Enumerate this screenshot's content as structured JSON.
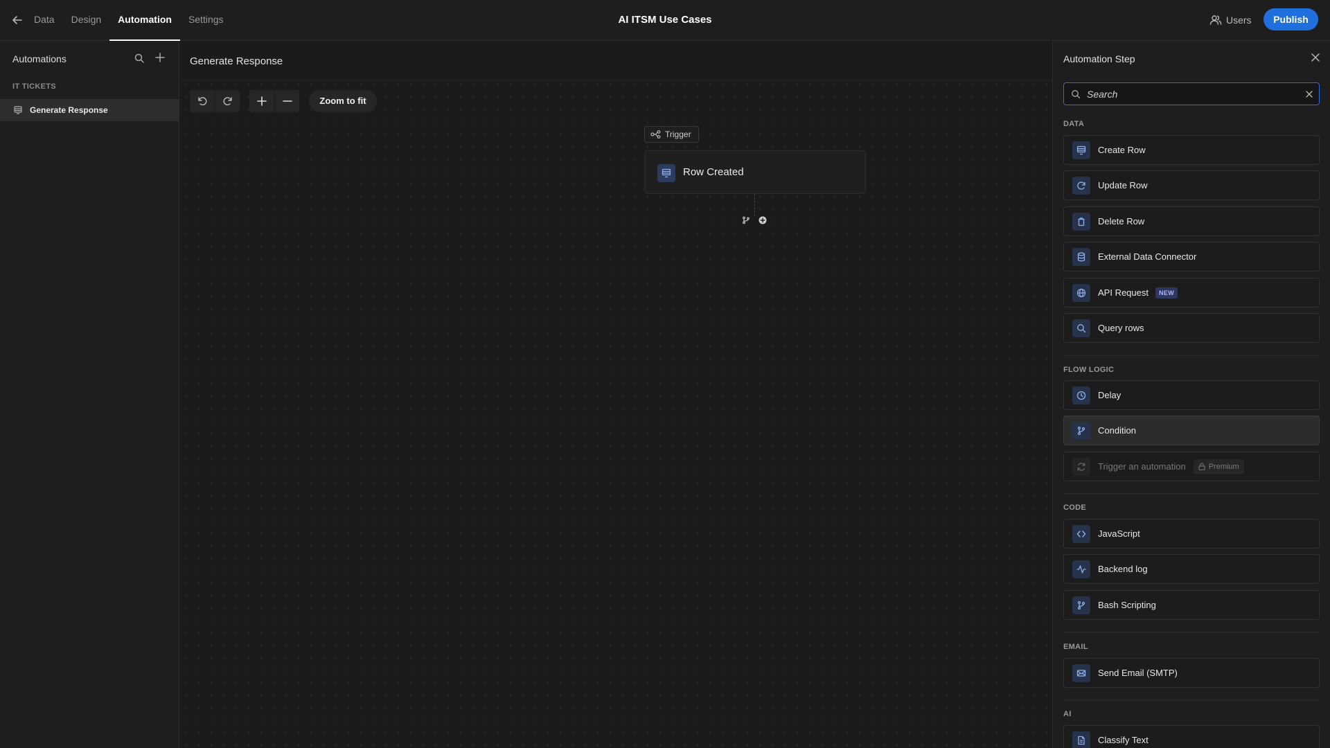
{
  "nav": {
    "back_icon": "arrow-left-icon",
    "tabs": [
      {
        "label": "Data",
        "active": false
      },
      {
        "label": "Design",
        "active": false
      },
      {
        "label": "Automation",
        "active": true
      },
      {
        "label": "Settings",
        "active": false
      }
    ],
    "app_title": "AI ITSM Use Cases",
    "users_label": "Users",
    "publish_label": "Publish"
  },
  "sidebar": {
    "title": "Automations",
    "section": "IT TICKETS",
    "items": [
      {
        "label": "Generate Response",
        "icon": "table-rows-icon",
        "selected": true
      }
    ]
  },
  "canvas": {
    "title": "Generate Response",
    "zoom_to_fit": "Zoom to fit",
    "trigger_tag": "Trigger",
    "node_label": "Row Created"
  },
  "panel": {
    "title": "Automation Step",
    "search_placeholder": "Search",
    "sections": [
      {
        "label": "DATA",
        "steps": [
          {
            "label": "Create Row",
            "icon": "table-rows-icon"
          },
          {
            "label": "Update Row",
            "icon": "refresh-icon"
          },
          {
            "label": "Delete Row",
            "icon": "trash-icon"
          },
          {
            "label": "External Data Connector",
            "icon": "database-icon"
          },
          {
            "label": "API Request",
            "icon": "globe-icon",
            "badge": "NEW"
          },
          {
            "label": "Query rows",
            "icon": "search-icon"
          }
        ]
      },
      {
        "label": "FLOW LOGIC",
        "steps": [
          {
            "label": "Delay",
            "icon": "clock-icon"
          },
          {
            "label": "Condition",
            "icon": "git-branch-icon"
          },
          {
            "label": "Trigger an automation",
            "icon": "sync-icon",
            "badge": "Premium"
          }
        ]
      },
      {
        "label": "CODE",
        "steps": [
          {
            "label": "JavaScript",
            "icon": "code-icon"
          },
          {
            "label": "Backend log",
            "icon": "activity-icon"
          },
          {
            "label": "Bash Scripting",
            "icon": "git-branch-icon"
          }
        ]
      },
      {
        "label": "EMAIL",
        "steps": [
          {
            "label": "Send Email (SMTP)",
            "icon": "mail-icon"
          }
        ]
      },
      {
        "label": "AI",
        "steps": [
          {
            "label": "Classify Text",
            "icon": "document-icon"
          }
        ]
      }
    ]
  },
  "colors": {
    "accent": "#1f6fdc",
    "background": "#1a1a1a",
    "panel": "#1e1e1e",
    "icon_tile": "#27334a",
    "icon_stroke": "#8fb0ea"
  }
}
